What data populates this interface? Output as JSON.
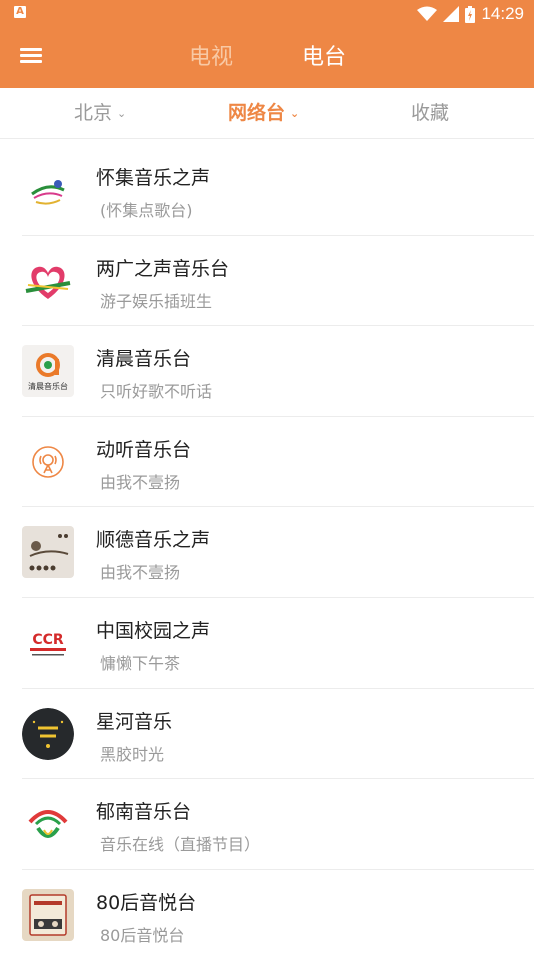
{
  "status": {
    "time": "14:29"
  },
  "header": {
    "tabs": [
      {
        "label": "电视"
      },
      {
        "label": "电台"
      }
    ],
    "active_tab": "电台"
  },
  "subnav": {
    "items": [
      {
        "label": "北京"
      },
      {
        "label": "网络台"
      },
      {
        "label": "收藏"
      }
    ],
    "active": "网络台"
  },
  "colors": {
    "accent": "#ee8745",
    "title": "#222222",
    "subtitle": "#9a9a9a"
  },
  "stations": [
    {
      "name": "怀集音乐之声",
      "desc": "(怀集点歌台)",
      "logo_icon": "huaiji-music-logo"
    },
    {
      "name": "两广之声音乐台",
      "desc": "游子娱乐插班生",
      "logo_icon": "lianguang-heart-logo"
    },
    {
      "name": "清晨音乐台",
      "desc": "只听好歌不听话",
      "logo_icon": "qingchen-logo",
      "logo_text": "清晨音乐台"
    },
    {
      "name": "动听音乐台",
      "desc": "由我不壹扬",
      "logo_icon": "radio-tower-icon"
    },
    {
      "name": "顺德音乐之声",
      "desc": "由我不壹扬",
      "logo_icon": "shunde-logo"
    },
    {
      "name": "中国校园之声",
      "desc": "慵懒下午茶",
      "logo_icon": "ccr-logo",
      "logo_text": "CCR"
    },
    {
      "name": "星河音乐",
      "desc": "黑胶时光",
      "logo_icon": "xinghe-logo"
    },
    {
      "name": "郁南音乐台",
      "desc": "音乐在线（直播节目）",
      "logo_icon": "yunan-logo"
    },
    {
      "name": "80后音悦台",
      "desc": "80后音悦台",
      "logo_icon": "80s-logo"
    }
  ]
}
